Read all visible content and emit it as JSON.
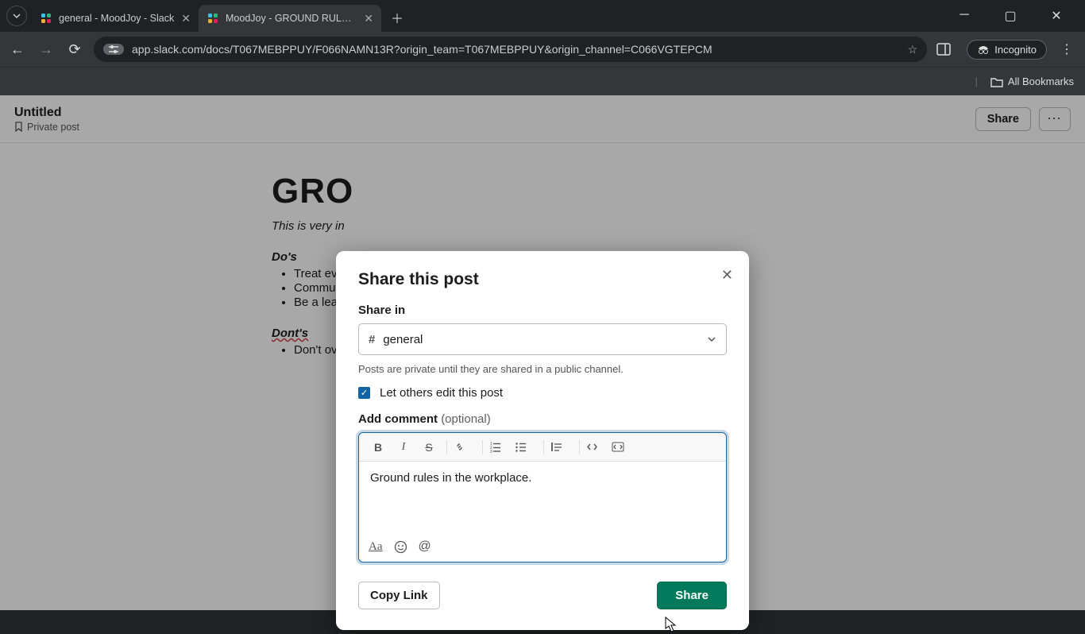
{
  "browser": {
    "tabs": [
      {
        "title": "general - MoodJoy - Slack",
        "active": false
      },
      {
        "title": "MoodJoy - GROUND RULES - S",
        "active": true
      }
    ],
    "url": "app.slack.com/docs/T067MEBPPUY/F066NAMN13R?origin_team=T067MEBPPUY&origin_channel=C066VGTEPCM",
    "incognito_label": "Incognito",
    "all_bookmarks": "All Bookmarks"
  },
  "doc_header": {
    "title": "Untitled",
    "privacy": "Private post",
    "share_btn": "Share"
  },
  "doc": {
    "h1": "GRO",
    "intro": "This is very in",
    "dos_heading": "Do's",
    "dos": [
      "Treat eve",
      "Commun",
      "Be a lead"
    ],
    "donts_heading": "Dont's",
    "donts": [
      "Don't ov"
    ]
  },
  "modal": {
    "title": "Share this post",
    "share_in_label": "Share in",
    "channel": "general",
    "hint": "Posts are private until they are shared in a public channel.",
    "edit_label": "Let others edit this post",
    "edit_checked": true,
    "comment_label": "Add comment",
    "comment_optional": "(optional)",
    "comment_text": "Ground rules in the workplace.",
    "copy_link": "Copy Link",
    "share_btn": "Share",
    "toolbar": {
      "bold": "B",
      "italic": "I",
      "strike": "S",
      "link": "link",
      "ol": "ol",
      "ul": "ul",
      "quote": "quote",
      "code": "code",
      "codeblock": "codeblock"
    },
    "footer": {
      "aa": "Aa",
      "emoji": "emoji",
      "mention": "@"
    }
  }
}
